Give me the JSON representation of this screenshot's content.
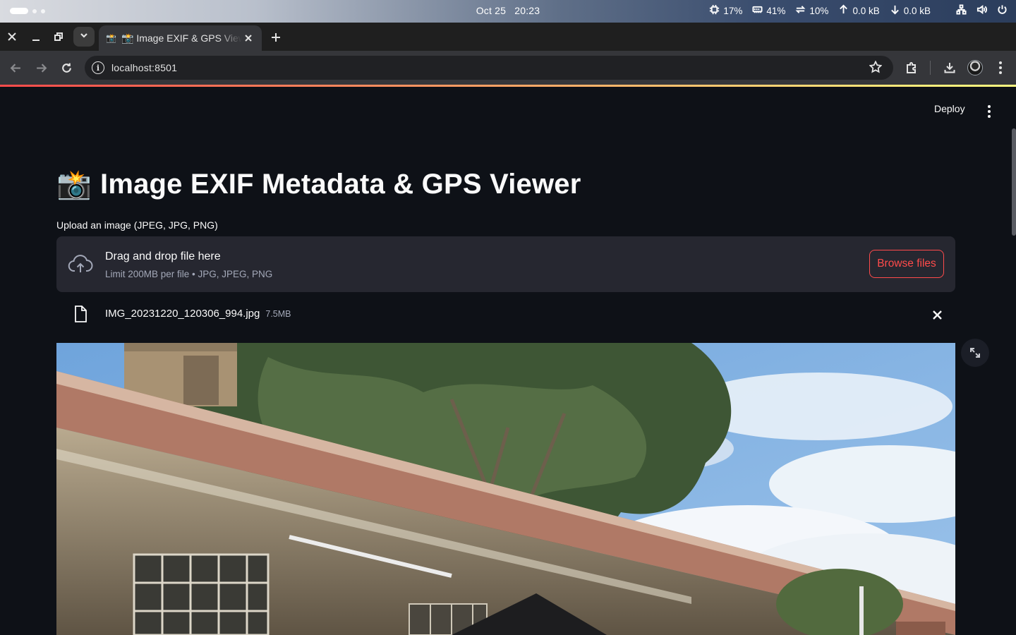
{
  "os": {
    "date": "Oct 25",
    "time": "20:23",
    "cpu": "17%",
    "memory": "41%",
    "swap": "10%",
    "upload": "0.0 kB",
    "download": "0.0 kB"
  },
  "browser": {
    "tab_favicon": "📸",
    "tab_title": "📸 Image EXIF & GPS Viewer",
    "url": "localhost:8501"
  },
  "app": {
    "deploy_label": "Deploy",
    "title_emoji": "📸",
    "title": "Image EXIF Metadata & GPS Viewer",
    "uploader_label": "Upload an image (JPEG, JPG, PNG)",
    "dropzone_title": "Drag and drop file here",
    "dropzone_limit": "Limit 200MB per file • JPG, JPEG, PNG",
    "browse_label": "Browse files",
    "file_name": "IMG_20231220_120306_994.jpg",
    "file_size": "7.5MB"
  },
  "colors": {
    "app_bg": "#0e1117",
    "primary": "#ff4b4b",
    "secondary_bg": "#262730",
    "text": "#fafafa"
  }
}
